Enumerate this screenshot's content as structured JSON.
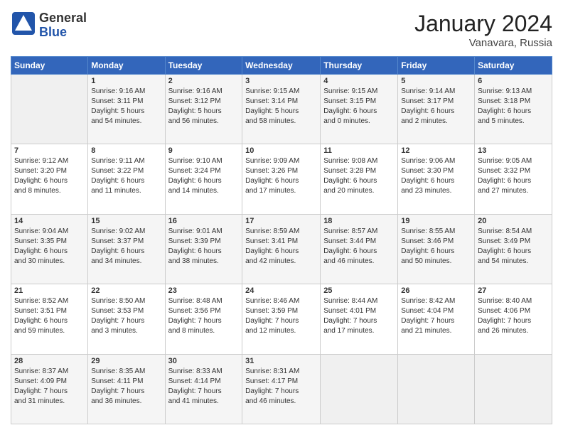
{
  "header": {
    "logo_general": "General",
    "logo_blue": "Blue",
    "month_title": "January 2024",
    "location": "Vanavara, Russia"
  },
  "days_of_week": [
    "Sunday",
    "Monday",
    "Tuesday",
    "Wednesday",
    "Thursday",
    "Friday",
    "Saturday"
  ],
  "weeks": [
    [
      {
        "day": "",
        "info": ""
      },
      {
        "day": "1",
        "info": "Sunrise: 9:16 AM\nSunset: 3:11 PM\nDaylight: 5 hours\nand 54 minutes."
      },
      {
        "day": "2",
        "info": "Sunrise: 9:16 AM\nSunset: 3:12 PM\nDaylight: 5 hours\nand 56 minutes."
      },
      {
        "day": "3",
        "info": "Sunrise: 9:15 AM\nSunset: 3:14 PM\nDaylight: 5 hours\nand 58 minutes."
      },
      {
        "day": "4",
        "info": "Sunrise: 9:15 AM\nSunset: 3:15 PM\nDaylight: 6 hours\nand 0 minutes."
      },
      {
        "day": "5",
        "info": "Sunrise: 9:14 AM\nSunset: 3:17 PM\nDaylight: 6 hours\nand 2 minutes."
      },
      {
        "day": "6",
        "info": "Sunrise: 9:13 AM\nSunset: 3:18 PM\nDaylight: 6 hours\nand 5 minutes."
      }
    ],
    [
      {
        "day": "7",
        "info": "Sunrise: 9:12 AM\nSunset: 3:20 PM\nDaylight: 6 hours\nand 8 minutes."
      },
      {
        "day": "8",
        "info": "Sunrise: 9:11 AM\nSunset: 3:22 PM\nDaylight: 6 hours\nand 11 minutes."
      },
      {
        "day": "9",
        "info": "Sunrise: 9:10 AM\nSunset: 3:24 PM\nDaylight: 6 hours\nand 14 minutes."
      },
      {
        "day": "10",
        "info": "Sunrise: 9:09 AM\nSunset: 3:26 PM\nDaylight: 6 hours\nand 17 minutes."
      },
      {
        "day": "11",
        "info": "Sunrise: 9:08 AM\nSunset: 3:28 PM\nDaylight: 6 hours\nand 20 minutes."
      },
      {
        "day": "12",
        "info": "Sunrise: 9:06 AM\nSunset: 3:30 PM\nDaylight: 6 hours\nand 23 minutes."
      },
      {
        "day": "13",
        "info": "Sunrise: 9:05 AM\nSunset: 3:32 PM\nDaylight: 6 hours\nand 27 minutes."
      }
    ],
    [
      {
        "day": "14",
        "info": "Sunrise: 9:04 AM\nSunset: 3:35 PM\nDaylight: 6 hours\nand 30 minutes."
      },
      {
        "day": "15",
        "info": "Sunrise: 9:02 AM\nSunset: 3:37 PM\nDaylight: 6 hours\nand 34 minutes."
      },
      {
        "day": "16",
        "info": "Sunrise: 9:01 AM\nSunset: 3:39 PM\nDaylight: 6 hours\nand 38 minutes."
      },
      {
        "day": "17",
        "info": "Sunrise: 8:59 AM\nSunset: 3:41 PM\nDaylight: 6 hours\nand 42 minutes."
      },
      {
        "day": "18",
        "info": "Sunrise: 8:57 AM\nSunset: 3:44 PM\nDaylight: 6 hours\nand 46 minutes."
      },
      {
        "day": "19",
        "info": "Sunrise: 8:55 AM\nSunset: 3:46 PM\nDaylight: 6 hours\nand 50 minutes."
      },
      {
        "day": "20",
        "info": "Sunrise: 8:54 AM\nSunset: 3:49 PM\nDaylight: 6 hours\nand 54 minutes."
      }
    ],
    [
      {
        "day": "21",
        "info": "Sunrise: 8:52 AM\nSunset: 3:51 PM\nDaylight: 6 hours\nand 59 minutes."
      },
      {
        "day": "22",
        "info": "Sunrise: 8:50 AM\nSunset: 3:53 PM\nDaylight: 7 hours\nand 3 minutes."
      },
      {
        "day": "23",
        "info": "Sunrise: 8:48 AM\nSunset: 3:56 PM\nDaylight: 7 hours\nand 8 minutes."
      },
      {
        "day": "24",
        "info": "Sunrise: 8:46 AM\nSunset: 3:59 PM\nDaylight: 7 hours\nand 12 minutes."
      },
      {
        "day": "25",
        "info": "Sunrise: 8:44 AM\nSunset: 4:01 PM\nDaylight: 7 hours\nand 17 minutes."
      },
      {
        "day": "26",
        "info": "Sunrise: 8:42 AM\nSunset: 4:04 PM\nDaylight: 7 hours\nand 21 minutes."
      },
      {
        "day": "27",
        "info": "Sunrise: 8:40 AM\nSunset: 4:06 PM\nDaylight: 7 hours\nand 26 minutes."
      }
    ],
    [
      {
        "day": "28",
        "info": "Sunrise: 8:37 AM\nSunset: 4:09 PM\nDaylight: 7 hours\nand 31 minutes."
      },
      {
        "day": "29",
        "info": "Sunrise: 8:35 AM\nSunset: 4:11 PM\nDaylight: 7 hours\nand 36 minutes."
      },
      {
        "day": "30",
        "info": "Sunrise: 8:33 AM\nSunset: 4:14 PM\nDaylight: 7 hours\nand 41 minutes."
      },
      {
        "day": "31",
        "info": "Sunrise: 8:31 AM\nSunset: 4:17 PM\nDaylight: 7 hours\nand 46 minutes."
      },
      {
        "day": "",
        "info": ""
      },
      {
        "day": "",
        "info": ""
      },
      {
        "day": "",
        "info": ""
      }
    ]
  ]
}
